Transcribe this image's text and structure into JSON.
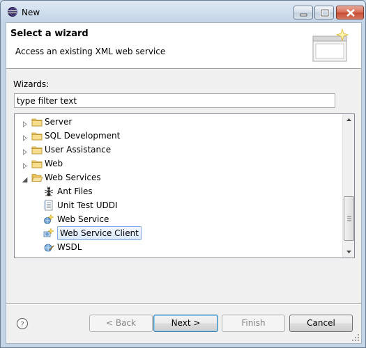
{
  "window": {
    "title": "New",
    "controls": [
      "minimize-icon",
      "maximize-icon",
      "close-icon"
    ]
  },
  "header": {
    "title": "Select a wizard",
    "description": "Access an existing XML web service",
    "banner_icon": "wizard-banner-icon"
  },
  "filter": {
    "label": "Wizards:",
    "value": "type filter text"
  },
  "tree": {
    "items": [
      {
        "label": "Server",
        "level": 0,
        "expanded": false,
        "icon": "folder-icon"
      },
      {
        "label": "SQL Development",
        "level": 0,
        "expanded": false,
        "icon": "folder-icon"
      },
      {
        "label": "User Assistance",
        "level": 0,
        "expanded": false,
        "icon": "folder-icon"
      },
      {
        "label": "Web",
        "level": 0,
        "expanded": false,
        "icon": "folder-icon"
      },
      {
        "label": "Web Services",
        "level": 0,
        "expanded": true,
        "icon": "folder-open-icon"
      },
      {
        "label": "Ant Files",
        "level": 1,
        "icon": "ant-icon"
      },
      {
        "label": "Unit Test UDDI",
        "level": 1,
        "icon": "document-icon"
      },
      {
        "label": "Web Service",
        "level": 1,
        "icon": "web-service-icon"
      },
      {
        "label": "Web Service Client",
        "level": 1,
        "icon": "web-service-client-icon",
        "selected": true
      },
      {
        "label": "WSDL",
        "level": 1,
        "icon": "wsdl-icon"
      }
    ]
  },
  "buttons": {
    "help_icon": "help-icon",
    "back": "< Back",
    "next": "Next >",
    "finish": "Finish",
    "cancel": "Cancel"
  },
  "colors": {
    "selection_border": "#84acdd",
    "folder": "#e8c25a",
    "default_button_border": "#3c7fb1"
  }
}
